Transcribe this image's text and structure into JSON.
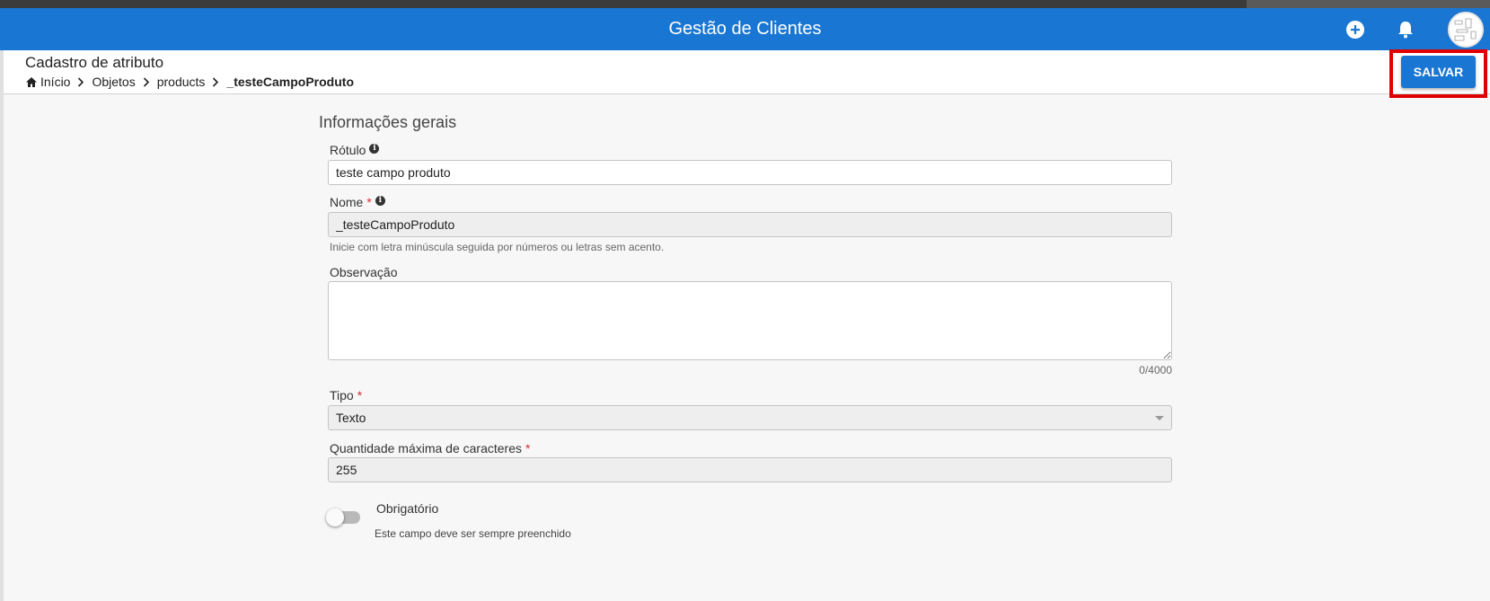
{
  "appbar": {
    "title": "Gestão de Clientes",
    "icons": [
      "add-circle-icon",
      "bell-icon"
    ],
    "colors": {
      "primary": "#1976d2"
    }
  },
  "header": {
    "title": "Cadastro de atributo",
    "breadcrumb": [
      "Início",
      "Objetos",
      "products",
      "_testeCampoProduto"
    ],
    "save_label": "SALVAR"
  },
  "form": {
    "section_title": "Informações gerais",
    "rotulo": {
      "label": "Rótulo",
      "value": "teste campo produto"
    },
    "nome": {
      "label": "Nome",
      "required": "*",
      "value": "_testeCampoProduto",
      "hint": "Inicie com letra minúscula seguida por números ou letras sem acento."
    },
    "observacao": {
      "label": "Observação",
      "value": "",
      "counter": "0/4000"
    },
    "tipo": {
      "label": "Tipo",
      "required": "*",
      "value": "Texto"
    },
    "max_chars": {
      "label": "Quantidade máxima de caracteres",
      "required": "*",
      "value": "255"
    },
    "obrigatorio": {
      "label": "Obrigatório",
      "hint": "Este campo deve ser sempre preenchido",
      "checked": false
    }
  }
}
